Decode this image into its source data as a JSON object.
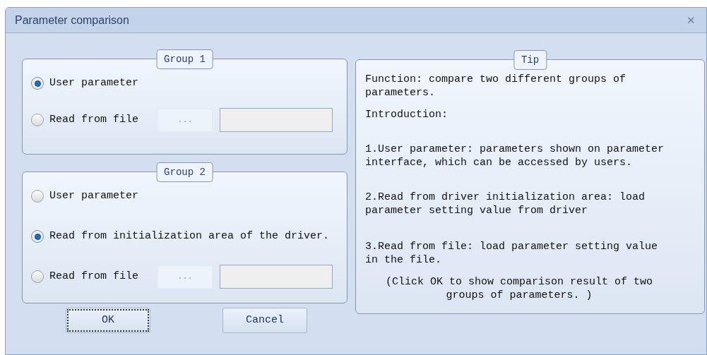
{
  "window": {
    "title": "Parameter comparison",
    "close_glyph": "✕"
  },
  "groups": [
    {
      "title": "Group 1",
      "options": [
        {
          "kind": "plain",
          "label": "User parameter",
          "selected": true
        },
        {
          "kind": "file",
          "label": "Read from file",
          "selected": false,
          "browse": "..."
        }
      ]
    },
    {
      "title": "Group 2",
      "options": [
        {
          "kind": "plain",
          "label": "User parameter",
          "selected": false
        },
        {
          "kind": "plain",
          "label": "Read from initialization area of the driver.",
          "selected": true
        },
        {
          "kind": "file",
          "label": "Read from file",
          "selected": false,
          "browse": "..."
        }
      ]
    }
  ],
  "tip": {
    "title": "Tip",
    "paragraphs": [
      {
        "kind": "body",
        "text": "Function: compare two different groups of parameters."
      },
      {
        "kind": "body",
        "text": "Introduction:"
      },
      {
        "kind": "body",
        "text": "1.User parameter: parameters shown on parameter interface, which can be accessed by users."
      },
      {
        "kind": "body",
        "text": "2.Read from driver initialization area: load parameter setting value from driver"
      },
      {
        "kind": "body",
        "text": "3.Read from file: load parameter setting value in the file."
      },
      {
        "kind": "note",
        "text": "(Click OK to show comparison result of two groups of parameters. )"
      }
    ]
  },
  "buttons": [
    {
      "label": "OK",
      "focused": true
    },
    {
      "label": "Cancel",
      "focused": false
    }
  ]
}
